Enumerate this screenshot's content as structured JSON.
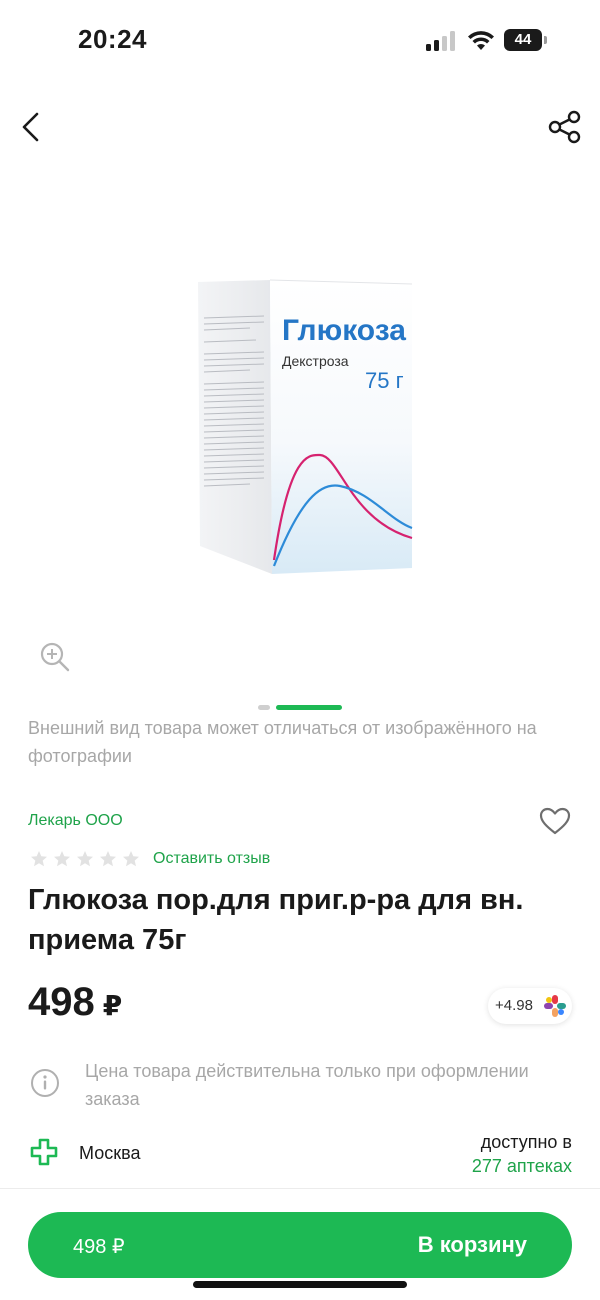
{
  "status_bar": {
    "time": "20:24",
    "battery": "44",
    "icons": [
      "cellular-signal-icon",
      "wifi-icon",
      "battery-icon"
    ]
  },
  "nav": {
    "back_icon": "chevron-left-icon",
    "share_icon": "share-icon"
  },
  "gallery": {
    "product_box": {
      "title": "Глюкоза",
      "subtitle": "Декстроза",
      "dose": "75 г"
    },
    "zoom_icon": "zoom-in-icon",
    "pages_total": 2,
    "active_page": 2
  },
  "disclaimer": "Внешний вид товара может отличаться от изображённого на фотографии",
  "product": {
    "seller": "Лекарь ООО",
    "favorite_icon": "heart-outline-icon",
    "rating_stars": 0,
    "max_stars": 5,
    "review_link": "Оставить отзыв",
    "title": "Глюкоза пор.для приг.р-ра для вн. приема 75г",
    "price": "498",
    "currency": "₽",
    "bonus": "+4.98",
    "bonus_icon": "bonus-flower-icon"
  },
  "price_note": {
    "icon": "info-icon",
    "text": "Цена товара действительна только при оформлении заказа"
  },
  "availability": {
    "icon": "pharmacy-cross-icon",
    "city": "Москва",
    "line1": "доступно в",
    "line2": "277 аптеках"
  },
  "cart": {
    "price": "498 ₽",
    "label": "В корзину"
  },
  "colors": {
    "accent": "#1db954",
    "link_green": "#1fa34a",
    "muted_text": "#a7a7a7",
    "box_blue": "#2476c6",
    "curve_pink": "#d6226f"
  }
}
